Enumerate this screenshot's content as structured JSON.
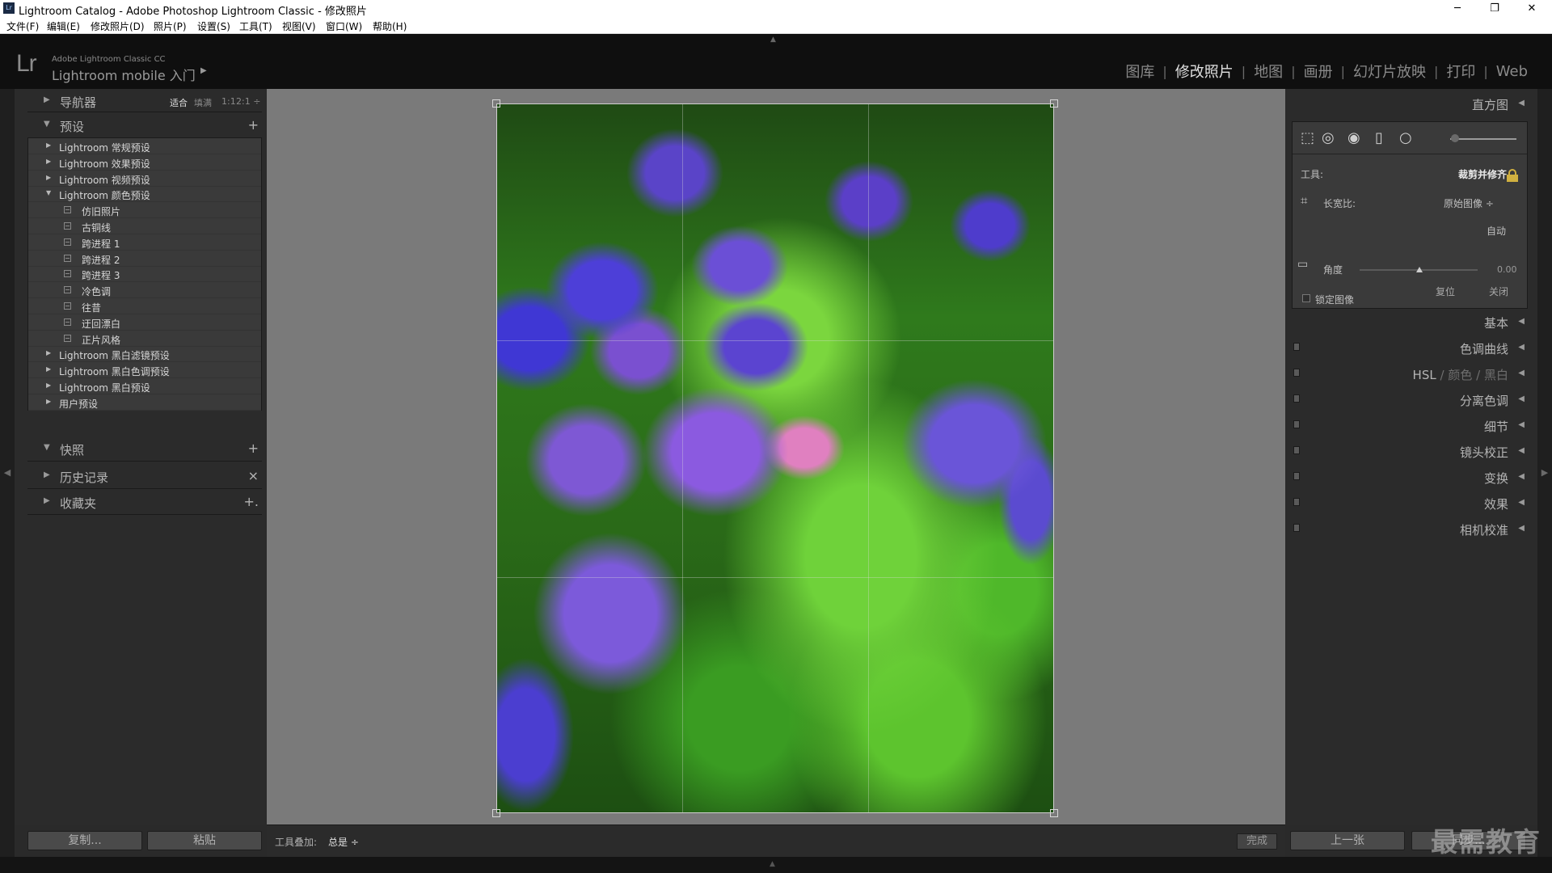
{
  "window": {
    "title": "Lightroom Catalog - Adobe Photoshop Lightroom Classic - 修改照片",
    "app_icon": "Lr",
    "controls": {
      "minimize": "─",
      "restore": "❐",
      "close": "✕"
    }
  },
  "menu": [
    "文件(F)",
    "编辑(E)",
    "修改照片(D)",
    "照片(P)",
    "设置(S)",
    "工具(T)",
    "视图(V)",
    "窗口(W)",
    "帮助(H)"
  ],
  "identity": {
    "logo": "Lr",
    "product_small": "Adobe Lightroom Classic CC",
    "product_main": "Lightroom mobile 入门",
    "arrow": "▶"
  },
  "modules": [
    {
      "label": "图库",
      "active": false
    },
    {
      "label": "修改照片",
      "active": true
    },
    {
      "label": "地图",
      "active": false
    },
    {
      "label": "画册",
      "active": false
    },
    {
      "label": "幻灯片放映",
      "active": false
    },
    {
      "label": "打印",
      "active": false
    },
    {
      "label": "Web",
      "active": false
    }
  ],
  "left_panel": {
    "navigator": {
      "label": "导航器",
      "zoom": [
        "适合",
        "填满",
        "1:1",
        "2:1 ÷"
      ],
      "active_zoom": "适合"
    },
    "presets": {
      "label": "预设",
      "action": "+",
      "items": [
        {
          "label": "Lightroom 常规预设",
          "type": "folder",
          "expanded": false
        },
        {
          "label": "Lightroom 效果预设",
          "type": "folder",
          "expanded": false
        },
        {
          "label": "Lightroom 视频预设",
          "type": "folder",
          "expanded": false
        },
        {
          "label": "Lightroom 颜色预设",
          "type": "folder",
          "expanded": true
        },
        {
          "label": "仿旧照片",
          "type": "preset"
        },
        {
          "label": "古铜线",
          "type": "preset"
        },
        {
          "label": "跨进程 1",
          "type": "preset"
        },
        {
          "label": "跨进程 2",
          "type": "preset"
        },
        {
          "label": "跨进程 3",
          "type": "preset"
        },
        {
          "label": "冷色调",
          "type": "preset"
        },
        {
          "label": "往昔",
          "type": "preset"
        },
        {
          "label": "迂回漂白",
          "type": "preset"
        },
        {
          "label": "正片风格",
          "type": "preset"
        },
        {
          "label": "Lightroom 黑白滤镜预设",
          "type": "folder",
          "expanded": false
        },
        {
          "label": "Lightroom 黑白色调预设",
          "type": "folder",
          "expanded": false
        },
        {
          "label": "Lightroom 黑白预设",
          "type": "folder",
          "expanded": false
        },
        {
          "label": "用户预设",
          "type": "folder",
          "expanded": false
        }
      ]
    },
    "snapshots": {
      "label": "快照",
      "action": "+"
    },
    "history": {
      "label": "历史记录",
      "action": "×"
    },
    "collections": {
      "label": "收藏夹",
      "action": "+."
    },
    "copy_button": "复制...",
    "paste_button": "粘贴"
  },
  "center": {
    "toolbar_label": "工具叠加:",
    "toolbar_value": "总是 ÷",
    "done_button": "完成"
  },
  "right_panel": {
    "histogram": "直方图",
    "crop": {
      "tool_label": "工具:",
      "tool_value": "裁剪并修齐",
      "aspect_label": "长宽比:",
      "aspect_value": "原始图像 ÷",
      "auto": "自动",
      "angle_label": "角度",
      "angle_value": "0.00",
      "constrain_label": "锁定图像",
      "reset": "复位",
      "close": "关闭"
    },
    "sections": [
      "基本",
      "色调曲线",
      "分离色调",
      "细节",
      "镜头校正",
      "变换",
      "效果",
      "相机校准"
    ],
    "hsl": {
      "a": "HSL",
      "b": "颜色",
      "c": "黑白",
      "sep": "/"
    },
    "prev_button": "上一张",
    "sync_button": "同步..."
  },
  "watermark": "最需教育",
  "icons": {
    "section_collapsed": "▶",
    "section_expanded": "▼",
    "panel_arrow": "◀"
  }
}
